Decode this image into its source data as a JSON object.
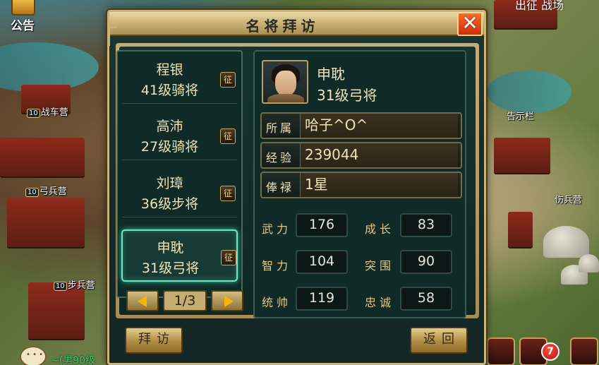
{
  "hud": {
    "notice_label": "公告",
    "top_right_text": "出征  战场",
    "chat_text": "~(男90级",
    "notification_count": "7"
  },
  "map_labels": [
    {
      "level": "10",
      "name": "战车营"
    },
    {
      "level": "10",
      "name": "弓兵营"
    },
    {
      "level": "10",
      "name": "步兵营"
    },
    {
      "level": "",
      "name": "告示栏"
    },
    {
      "level": "",
      "name": "伤兵营"
    }
  ],
  "dialog": {
    "title": "名将拜访",
    "close_symbol": "✕",
    "generals": [
      {
        "name": "程银",
        "level": "41级骑将",
        "action": "征"
      },
      {
        "name": "高沛",
        "level": "27级骑将",
        "action": "征"
      },
      {
        "name": "刘璋",
        "level": "36级步将",
        "action": "征"
      },
      {
        "name": "申耽",
        "level": "31级弓将",
        "action": "征"
      }
    ],
    "selected_index": 3,
    "pager": {
      "text": "1/3"
    },
    "detail": {
      "name": "申耽",
      "level": "31级弓将",
      "info": [
        {
          "label": "所属",
          "value": "哈子^O^"
        },
        {
          "label": "经验",
          "value": "239044"
        },
        {
          "label": "俸禄",
          "value": "1星"
        }
      ],
      "stats": [
        {
          "label": "武力",
          "value": "176"
        },
        {
          "label": "成长",
          "value": "83"
        },
        {
          "label": "智力",
          "value": "104"
        },
        {
          "label": "突围",
          "value": "90"
        },
        {
          "label": "统帅",
          "value": "119"
        },
        {
          "label": "忠诚",
          "value": "58"
        }
      ]
    },
    "buttons": {
      "visit": "拜访",
      "back": "返回"
    }
  }
}
